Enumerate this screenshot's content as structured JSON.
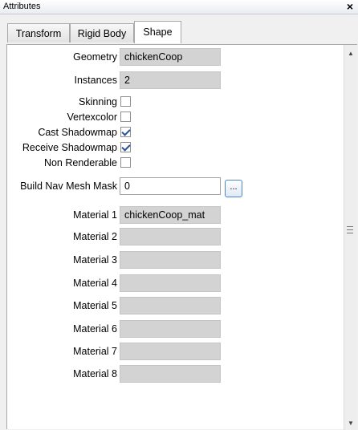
{
  "window": {
    "title": "Attributes",
    "close_glyph": "×"
  },
  "tabs": [
    {
      "label": "Transform",
      "active": false
    },
    {
      "label": "Rigid Body",
      "active": false
    },
    {
      "label": "Shape",
      "active": true
    }
  ],
  "fields": {
    "geometry": {
      "label": "Geometry",
      "value": "chickenCoop"
    },
    "instances": {
      "label": "Instances",
      "value": "2"
    },
    "skinning": {
      "label": "Skinning",
      "checked": false
    },
    "vertexcolor": {
      "label": "Vertexcolor",
      "checked": false
    },
    "cast_shadowmap": {
      "label": "Cast Shadowmap",
      "checked": true
    },
    "receive_shadowmap": {
      "label": "Receive Shadowmap",
      "checked": true
    },
    "non_renderable": {
      "label": "Non Renderable",
      "checked": false
    },
    "build_nav_mesh_mask": {
      "label": "Build Nav Mesh Mask",
      "value": "0",
      "button_label": "..."
    }
  },
  "materials": [
    {
      "label": "Material 1",
      "value": "chickenCoop_mat"
    },
    {
      "label": "Material 2",
      "value": ""
    },
    {
      "label": "Material 3",
      "value": ""
    },
    {
      "label": "Material 4",
      "value": ""
    },
    {
      "label": "Material 5",
      "value": ""
    },
    {
      "label": "Material 6",
      "value": ""
    },
    {
      "label": "Material 7",
      "value": ""
    },
    {
      "label": "Material 8",
      "value": ""
    }
  ],
  "scrollbar": {
    "up_glyph": "▲",
    "down_glyph": "▼"
  }
}
